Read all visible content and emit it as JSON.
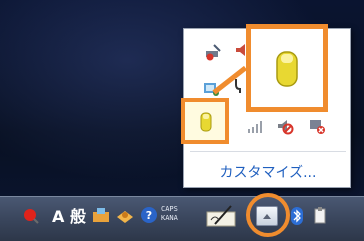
{
  "overflow_popup": {
    "customize_label": "カスタマイズ...",
    "icons": [
      "network-repair-icon",
      "speaker-icon",
      "user-accounts-icon",
      "cable-icon",
      "usb-drive-icon",
      "signal-bars-icon",
      "muted-speaker-icon",
      "disconnected-network-icon"
    ]
  },
  "taskbar": {
    "ime_label": "A",
    "ime_mode": "般",
    "caps_line1": "CAPS",
    "caps_line2": "KANA",
    "icons": [
      "red-pin-icon",
      "ime-toolbox-icon",
      "ime-dictionary-icon",
      "help-icon",
      "handwriting-pad-icon",
      "show-hidden-icons-button",
      "bluetooth-icon",
      "sync-icon"
    ]
  },
  "highlight_color": "#f08c2e",
  "link_color": "#1f5fbf"
}
